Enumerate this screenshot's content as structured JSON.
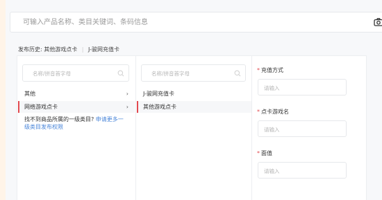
{
  "search": {
    "placeholder": "可输入产品名称、类目关键词、条码信息",
    "camera_icon": "camera-icon"
  },
  "history": {
    "label": "发布历史:",
    "items": [
      "其他游戏点卡",
      "J-骏网充值卡"
    ]
  },
  "category_col1": {
    "search_placeholder": "名称/拼音首字母",
    "items": [
      {
        "label": "其他",
        "arrow": "›"
      },
      {
        "label": "网络游戏点卡",
        "arrow": "›"
      }
    ],
    "not_found_text": "找不到商品所属的一级类目?",
    "not_found_link": "申请更多一级类目发布权限"
  },
  "category_col2": {
    "search_placeholder": "名称/拼音首字母",
    "items": [
      {
        "label": "J-骏网充值卡"
      },
      {
        "label": "其他游戏点卡"
      }
    ]
  },
  "form": {
    "fields": [
      {
        "required": "*",
        "label": "充值方式",
        "placeholder": "请输入"
      },
      {
        "required": "*",
        "label": "点卡游戏名",
        "placeholder": "请输入"
      },
      {
        "required": "*",
        "label": "面值",
        "placeholder": "请输入"
      }
    ]
  },
  "colors": {
    "accent_red": "#e2494f",
    "link_blue": "#4a86d9"
  }
}
